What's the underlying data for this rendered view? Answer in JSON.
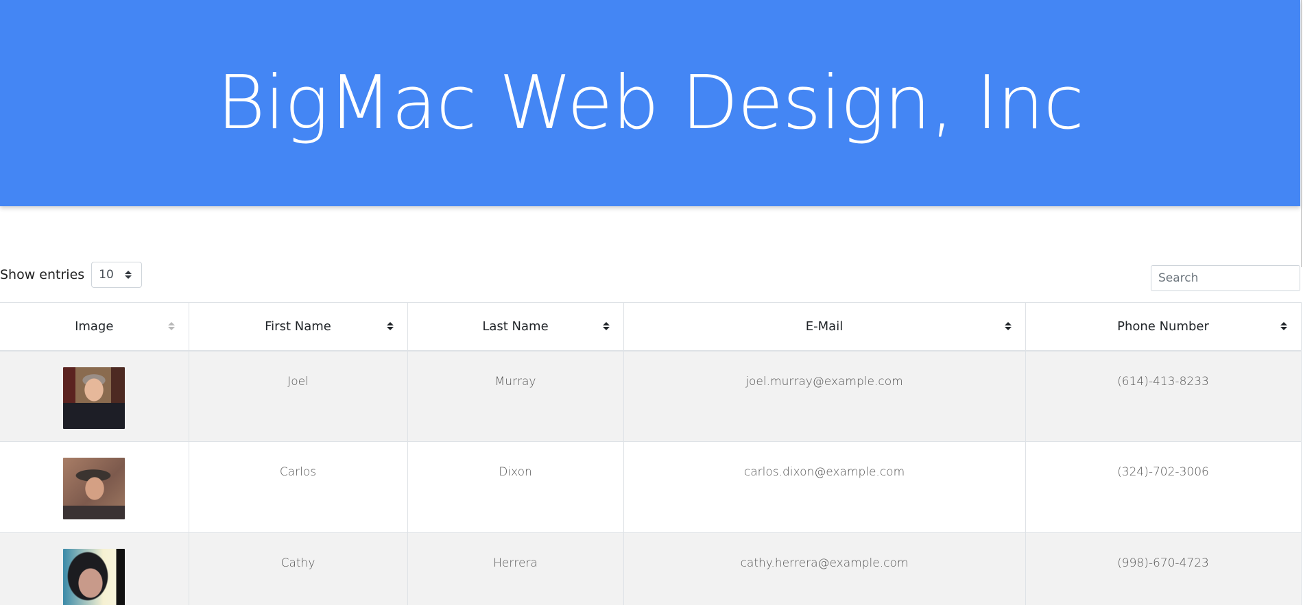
{
  "header": {
    "title": "BigMac Web Design, Inc"
  },
  "length": {
    "label": "Show entries",
    "value": "10"
  },
  "search": {
    "placeholder": "Search"
  },
  "table": {
    "columns": [
      {
        "label": "Image",
        "sort": "unsorted"
      },
      {
        "label": "First Name",
        "sort": "sortable"
      },
      {
        "label": "Last Name",
        "sort": "sortable"
      },
      {
        "label": "E-Mail",
        "sort": "sortable"
      },
      {
        "label": "Phone Number",
        "sort": "sortable"
      }
    ],
    "rows": [
      {
        "first": "Joel",
        "last": "Murray",
        "email": "joel.murray@example.com",
        "phone": "(614)-413-8233"
      },
      {
        "first": "Carlos",
        "last": "Dixon",
        "email": "carlos.dixon@example.com",
        "phone": "(324)-702-3006"
      },
      {
        "first": "Cathy",
        "last": "Herrera",
        "email": "cathy.herrera@example.com",
        "phone": "(998)-670-4723"
      }
    ]
  },
  "colors": {
    "header_bg": "#4486f4",
    "row_stripe": "#f2f2f2",
    "border": "#dee2e6"
  }
}
